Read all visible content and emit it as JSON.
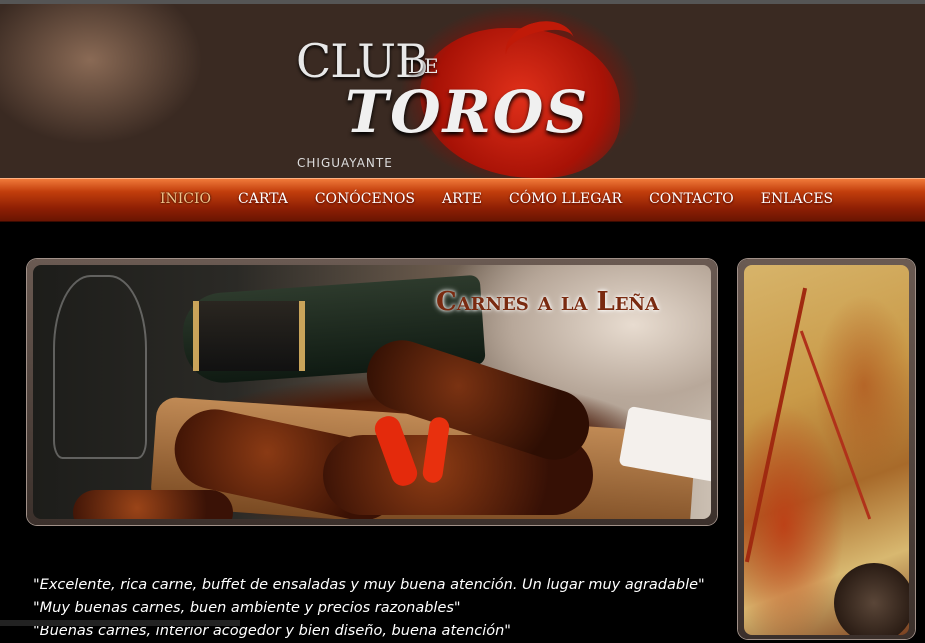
{
  "header": {
    "logo_club": "CLUB",
    "logo_de": "DE",
    "logo_toros": "TOROS",
    "logo_city": "CHIGUAYANTE"
  },
  "nav": {
    "items": [
      {
        "label": "INICIO",
        "active": true
      },
      {
        "label": "CARTA"
      },
      {
        "label": "CONÓCENOS"
      },
      {
        "label": "ARTE"
      },
      {
        "label": "CÓMO LLEGAR"
      },
      {
        "label": "CONTACTO"
      },
      {
        "label": "ENLACES"
      }
    ]
  },
  "hero": {
    "caption": "Carnes a la Leña"
  },
  "testimonials": [
    "\"Excelente, rica carne, buffet de ensaladas y muy buena atención. Un lugar muy agradable\"",
    "\"Muy buenas carnes, buen ambiente y precios razonables\"",
    "\"Buenas carnes, interior acogedor y bien diseño, buena atención\""
  ],
  "colors": {
    "nav_bar": "#c23e0c",
    "nav_active": "#f1c48a",
    "caption": "#7a2a10"
  }
}
